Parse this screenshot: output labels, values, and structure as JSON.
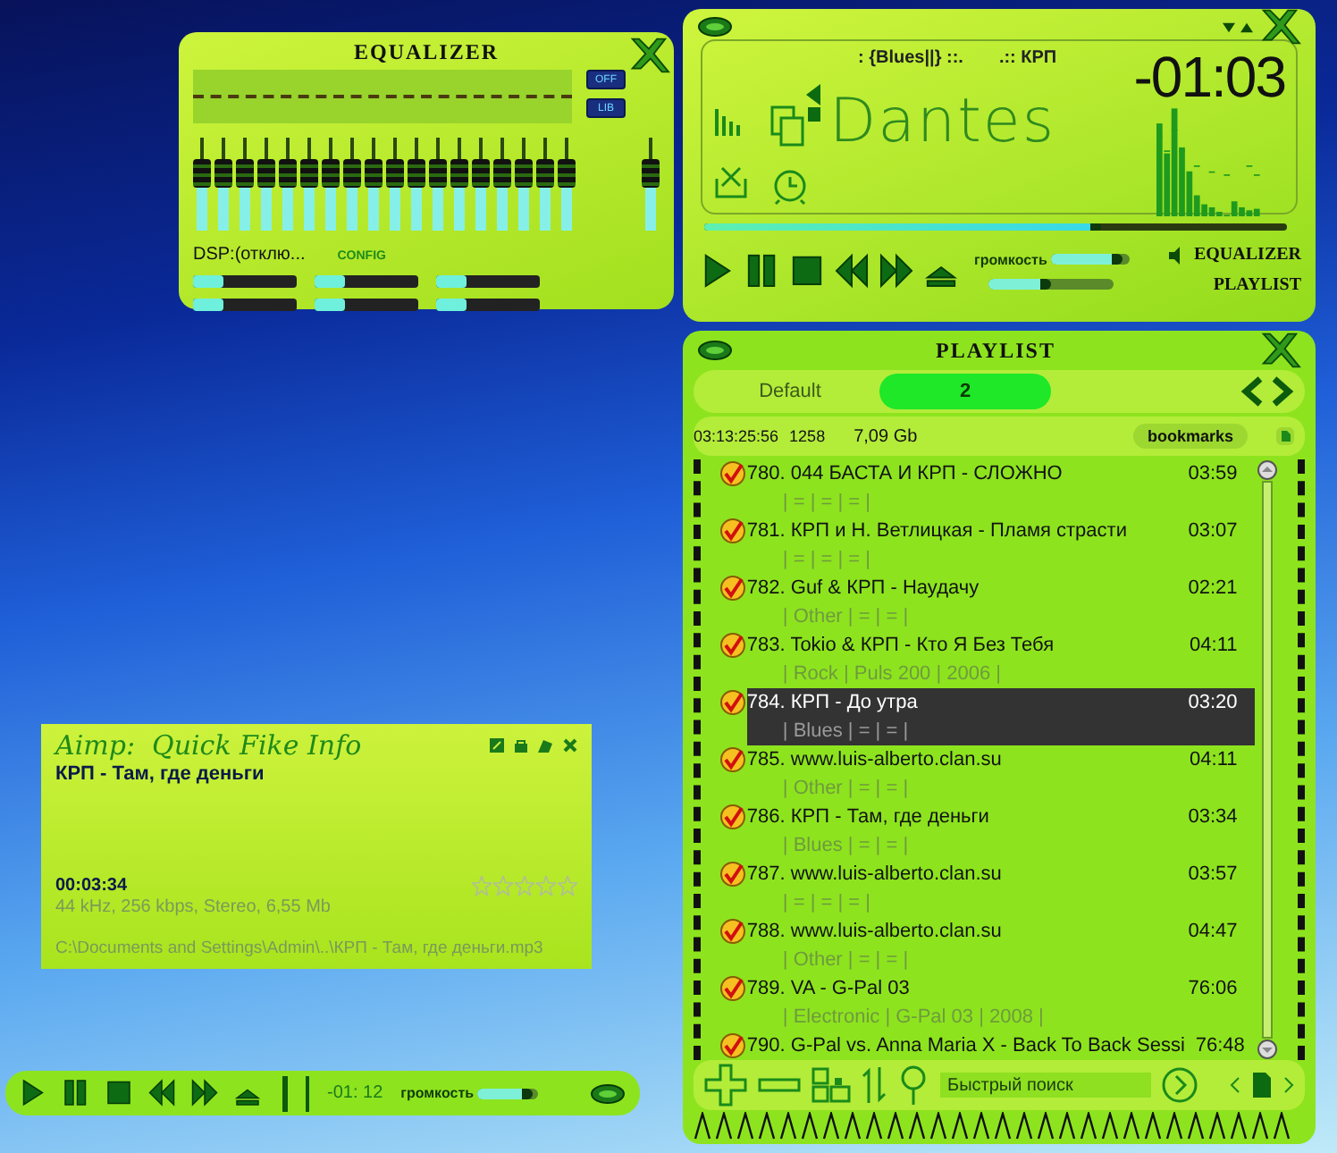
{
  "equalizer": {
    "title": "EQUALIZER",
    "buttons": [
      "OFF",
      "LIB"
    ],
    "bands": [
      {
        "level": 0.62
      },
      {
        "level": 0.62
      },
      {
        "level": 0.62
      },
      {
        "level": 0.62
      },
      {
        "level": 0.62
      },
      {
        "level": 0.62
      },
      {
        "level": 0.62
      },
      {
        "level": 0.62
      },
      {
        "level": 0.62
      },
      {
        "level": 0.62
      },
      {
        "level": 0.62
      },
      {
        "level": 0.62
      },
      {
        "level": 0.62
      },
      {
        "level": 0.62
      },
      {
        "level": 0.62
      },
      {
        "level": 0.62
      },
      {
        "level": 0.62
      },
      {
        "level": 0.62
      }
    ],
    "preamp": {
      "level": 0.62
    },
    "effects": [
      {
        "level": 0.3
      },
      {
        "level": 0.3
      },
      {
        "level": 0.3
      },
      {
        "level": 0.3
      },
      {
        "level": 0.3
      },
      {
        "level": 0.3
      }
    ],
    "dsp": "DSP:(отклю...",
    "config": "CONFIG"
  },
  "main_player": {
    "genre": ": {Blues||} ::.",
    "artist": ".:: КРП",
    "time": "-01:03",
    "title": "Dantes",
    "progress": {
      "level": 0.68
    },
    "volume": {
      "label": "громкость",
      "level": 0.92
    },
    "balance": {
      "level": 0.5
    },
    "links": [
      "EQUALIZER",
      "PLAYLIST"
    ]
  },
  "playlist": {
    "title": "PLAYLIST",
    "tabs": [
      {
        "label": "Default",
        "selected": false
      },
      {
        "label": "2",
        "selected": true
      }
    ],
    "stats": {
      "duration": "03:13:25:56",
      "count": "1258",
      "size": "7,09 Gb"
    },
    "bookmarks": "bookmarks",
    "rows": [
      {
        "title": "780. 044 БАСТА И КРП - СЛОЖНО",
        "time": "03:59",
        "tags": "| = | = | = |",
        "checked": true,
        "selected": false
      },
      {
        "title": "781. КРП и Н. Ветлицкая - Пламя страсти",
        "time": "03:07",
        "tags": "| = | = | = |",
        "checked": true,
        "selected": false
      },
      {
        "title": "782. Guf & КРП - Наудачу",
        "time": "02:21",
        "tags": "| Other | = | = |",
        "checked": true,
        "selected": false
      },
      {
        "title": "783. Tokio & КРП - Кто Я Без Тебя",
        "time": "04:11",
        "tags": "| Rock | Puls 200 | 2006 |",
        "checked": true,
        "selected": false
      },
      {
        "title": "784. КРП - До утра",
        "time": "03:20",
        "tags": "| Blues | = | = |",
        "checked": true,
        "selected": true
      },
      {
        "title": "785. www.luis-alberto.clan.su",
        "time": "04:11",
        "tags": "| Other | = | = |",
        "checked": true,
        "selected": false
      },
      {
        "title": "786. КРП - Там, где деньги",
        "time": "03:34",
        "tags": "| Blues | = | = |",
        "checked": true,
        "selected": false
      },
      {
        "title": "787. www.luis-alberto.clan.su",
        "time": "03:57",
        "tags": "| = | = | = |",
        "checked": true,
        "selected": false
      },
      {
        "title": "788. www.luis-alberto.clan.su",
        "time": "04:47",
        "tags": "| Other | = | = |",
        "checked": true,
        "selected": false
      },
      {
        "title": "789. VA - G-Pal 03",
        "time": "76:06",
        "tags": "| Electronic | G-Pal 03 | 2008 |",
        "checked": true,
        "selected": false
      },
      {
        "title": "790. G-Pal vs. Anna Maria X - Back To Back Sessi",
        "time": "76:48",
        "checked": true,
        "selected": false
      }
    ],
    "search": {
      "placeholder": "Быстрый поиск"
    }
  },
  "quick_info": {
    "title": "Aimp:  Quick Fike Info",
    "track": "КРП - Там, где деньги",
    "position": "00:03:34",
    "format": "44 kHz, 256 kbps, Stereo, 6,55 Mb",
    "stars": 0,
    "path": "C:\\Documents and Settings\\Admin\\..\\КРП - Там, где деньги.mp3"
  },
  "mini_bar": {
    "time": "-01: 12",
    "volume": {
      "label": "громкость",
      "level": 0.92
    }
  }
}
